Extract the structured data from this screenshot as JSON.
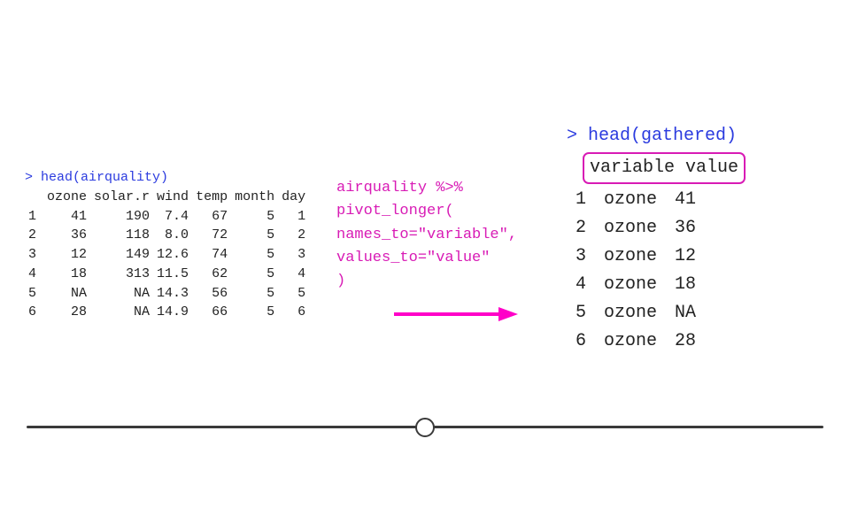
{
  "left": {
    "command_prompt": ">",
    "command_text": "head(airquality)",
    "headers": [
      "ozone",
      "solar.r",
      "wind",
      "temp",
      "month",
      "day"
    ],
    "rows": [
      {
        "n": "1",
        "ozone": "41",
        "solar": "190",
        "wind": "7.4",
        "temp": "67",
        "month": "5",
        "day": "1"
      },
      {
        "n": "2",
        "ozone": "36",
        "solar": "118",
        "wind": "8.0",
        "temp": "72",
        "month": "5",
        "day": "2"
      },
      {
        "n": "3",
        "ozone": "12",
        "solar": "149",
        "wind": "12.6",
        "temp": "74",
        "month": "5",
        "day": "3"
      },
      {
        "n": "4",
        "ozone": "18",
        "solar": "313",
        "wind": "11.5",
        "temp": "62",
        "month": "5",
        "day": "4"
      },
      {
        "n": "5",
        "ozone": "NA",
        "solar": "NA",
        "wind": "14.3",
        "temp": "56",
        "month": "5",
        "day": "5"
      },
      {
        "n": "6",
        "ozone": "28",
        "solar": "NA",
        "wind": "14.9",
        "temp": "66",
        "month": "5",
        "day": "6"
      }
    ]
  },
  "middle": {
    "line1": "airquality %>%",
    "line2": "pivot_longer(",
    "line3": "  names_to=\"variable\",",
    "line4": "  values_to=\"value\"",
    "line5": ")"
  },
  "right": {
    "command_prompt": ">",
    "command_text": "head(gathered)",
    "headers": [
      "variable",
      "value"
    ],
    "rows": [
      {
        "n": "1",
        "variable": "ozone",
        "value": "41"
      },
      {
        "n": "2",
        "variable": "ozone",
        "value": "36"
      },
      {
        "n": "3",
        "variable": "ozone",
        "value": "12"
      },
      {
        "n": "4",
        "variable": "ozone",
        "value": "18"
      },
      {
        "n": "5",
        "variable": "ozone",
        "value": "NA"
      },
      {
        "n": "6",
        "variable": "ozone",
        "value": "28"
      }
    ]
  },
  "chart_data": {
    "type": "table",
    "tables": [
      {
        "title": "head(airquality)",
        "headers": [
          "",
          "ozone",
          "solar.r",
          "wind",
          "temp",
          "month",
          "day"
        ],
        "rows": [
          [
            "1",
            41,
            190,
            7.4,
            67,
            5,
            1
          ],
          [
            "2",
            36,
            118,
            8.0,
            72,
            5,
            2
          ],
          [
            "3",
            12,
            149,
            12.6,
            74,
            5,
            3
          ],
          [
            "4",
            18,
            313,
            11.5,
            62,
            5,
            4
          ],
          [
            "5",
            "NA",
            "NA",
            14.3,
            56,
            5,
            5
          ],
          [
            "6",
            28,
            "NA",
            14.9,
            66,
            5,
            6
          ]
        ]
      },
      {
        "title": "head(gathered)",
        "headers": [
          "",
          "variable",
          "value"
        ],
        "rows": [
          [
            "1",
            "ozone",
            41
          ],
          [
            "2",
            "ozone",
            36
          ],
          [
            "3",
            "ozone",
            12
          ],
          [
            "4",
            "ozone",
            18
          ],
          [
            "5",
            "ozone",
            "NA"
          ],
          [
            "6",
            "ozone",
            28
          ]
        ]
      }
    ]
  }
}
